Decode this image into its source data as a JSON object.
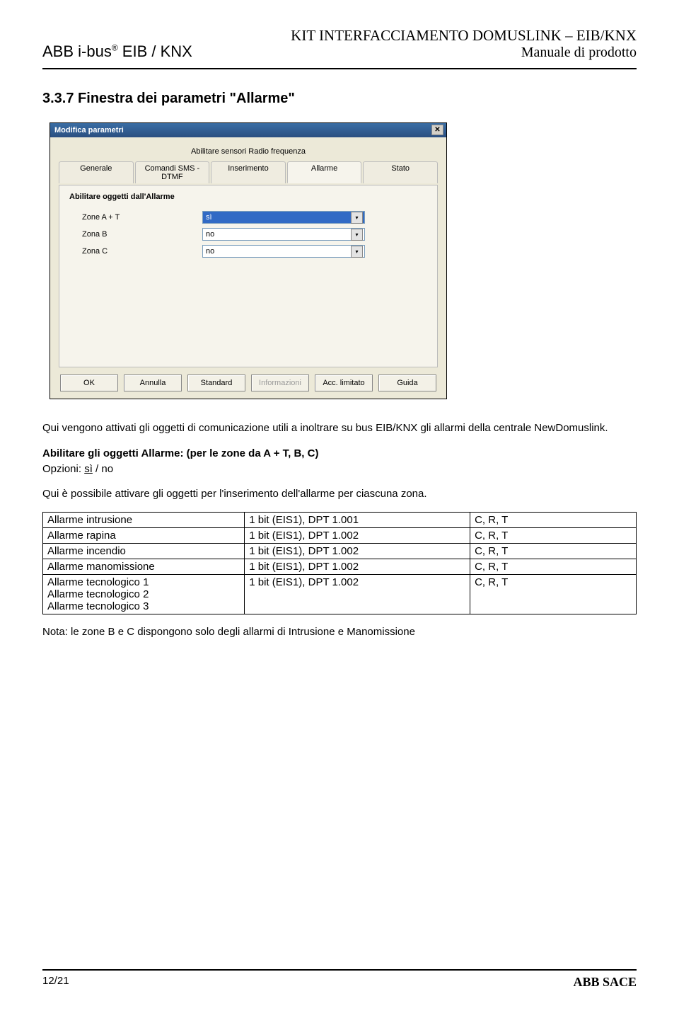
{
  "header": {
    "left_line1_a": "ABB i-bus",
    "left_line1_reg": "®",
    "left_line1_b": " EIB / KNX",
    "right_line1": "KIT INTERFACCIAMENTO DOMUSLINK – EIB/KNX",
    "right_line2": "Manuale di prodotto"
  },
  "section": {
    "heading": "3.3.7 Finestra dei parametri \"Allarme\""
  },
  "dialog": {
    "title": "Modifica parametri",
    "close_glyph": "✕",
    "top_label": "Abilitare sensori Radio frequenza",
    "tabs": [
      "Generale",
      "Comandi SMS - DTMF",
      "Inserimento",
      "Allarme",
      "Stato"
    ],
    "active_tab_index": 3,
    "panel_title": "Abilitare oggetti dall'Allarme",
    "rows": [
      {
        "label": "Zone A + T",
        "value": "sì",
        "selected": true
      },
      {
        "label": "Zona B",
        "value": "no",
        "selected": false
      },
      {
        "label": "Zona C",
        "value": "no",
        "selected": false
      }
    ],
    "arrow_glyph": "▾",
    "buttons": [
      {
        "label": "OK",
        "disabled": false
      },
      {
        "label": "Annulla",
        "disabled": false
      },
      {
        "label": "Standard",
        "disabled": false
      },
      {
        "label": "Informazioni",
        "disabled": true
      },
      {
        "label": "Acc. limitato",
        "disabled": false
      },
      {
        "label": "Guida",
        "disabled": false
      }
    ]
  },
  "body": {
    "p1": "Qui vengono attivati gli oggetti di comunicazione utili a inoltrare su bus EIB/KNX gli allarmi della centrale NewDomuslink.",
    "p2_bold": "Abilitare gli oggetti Allarme: (per le zone da A + T, B, C)",
    "p2_opts_label": "Opzioni: ",
    "p2_opts_under": "sì",
    "p2_opts_rest": " / no",
    "p3": "Qui è possibile attivare gli oggetti per l'inserimento dell'allarme per ciascuna zona.",
    "table": [
      {
        "c1": "Allarme intrusione",
        "c2": "1 bit (EIS1), DPT 1.001",
        "c3": "C, R, T"
      },
      {
        "c1": "Allarme rapina",
        "c2": "1 bit (EIS1), DPT 1.002",
        "c3": "C, R, T"
      },
      {
        "c1": "Allarme incendio",
        "c2": "1 bit (EIS1), DPT 1.002",
        "c3": "C, R, T"
      },
      {
        "c1": "Allarme manomissione",
        "c2": "1 bit (EIS1), DPT 1.002",
        "c3": "C, R, T"
      },
      {
        "c1": "Allarme tecnologico 1\nAllarme tecnologico 2\nAllarme tecnologico 3",
        "c2": "1 bit (EIS1), DPT 1.002",
        "c3": "C, R, T"
      }
    ],
    "note": "Nota: le zone B e C dispongono solo degli allarmi di Intrusione e Manomissione"
  },
  "footer": {
    "page": "12/21",
    "brand": "ABB SACE"
  }
}
